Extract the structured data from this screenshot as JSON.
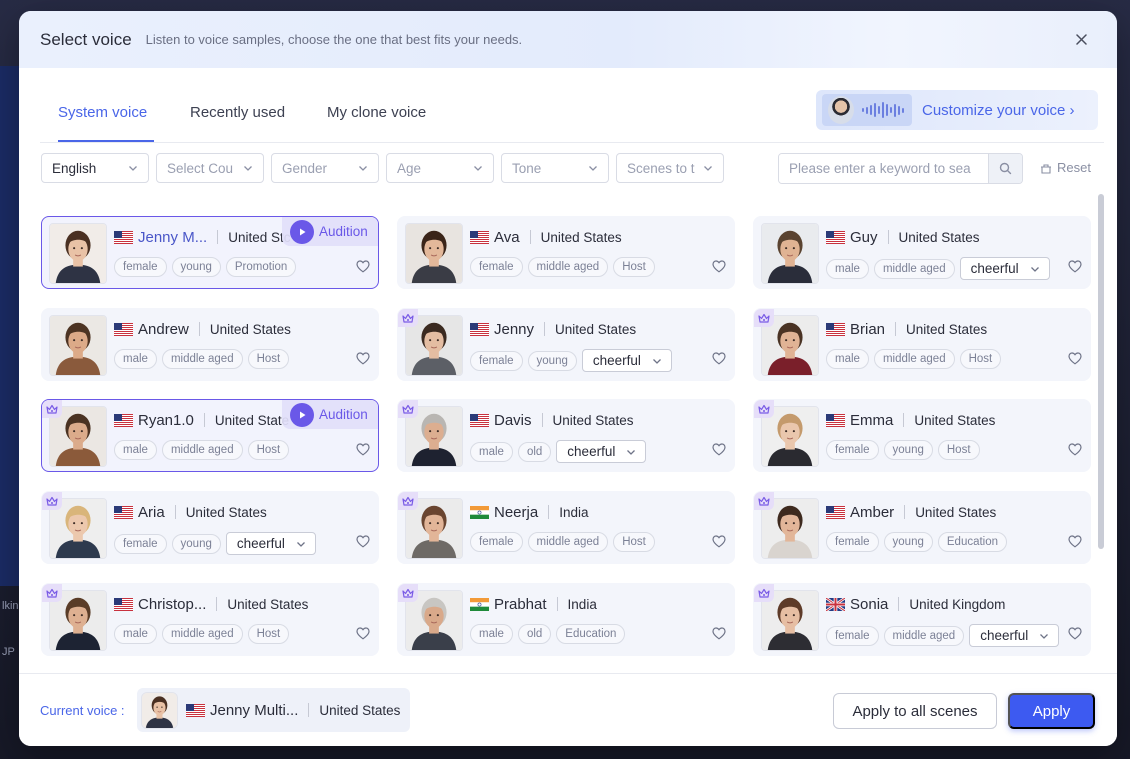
{
  "header": {
    "title": "Select voice",
    "subtitle": "Listen to voice samples, choose the one that best fits your needs."
  },
  "tabs": [
    {
      "label": "System voice",
      "active": true
    },
    {
      "label": "Recently used",
      "active": false
    },
    {
      "label": "My clone voice",
      "active": false
    }
  ],
  "customize": {
    "label": "Customize your voice ›"
  },
  "filters": [
    {
      "value": "English",
      "placeholder": false
    },
    {
      "value": "Select Cou",
      "placeholder": true
    },
    {
      "value": "Gender",
      "placeholder": true
    },
    {
      "value": "Age",
      "placeholder": true
    },
    {
      "value": "Tone",
      "placeholder": true
    },
    {
      "value": "Scenes to t",
      "placeholder": true
    }
  ],
  "search": {
    "placeholder": "Please enter a keyword to sea"
  },
  "reset_label": "Reset",
  "audition_label": "Audition",
  "voices": [
    {
      "name": "Jenny M...",
      "country": "United Stc",
      "flag": "us",
      "tags": [
        "female",
        "young",
        "Promotion"
      ],
      "tone": null,
      "premium": false,
      "selected": true,
      "audition": true,
      "face": {
        "hair": "#4a3022",
        "skin": "#e9c2a6",
        "cloth": "#2e3344",
        "bg": "#f1ece8"
      }
    },
    {
      "name": "Ava",
      "country": "United States",
      "flag": "us",
      "tags": [
        "female",
        "middle aged",
        "Host"
      ],
      "tone": null,
      "premium": false,
      "selected": false,
      "audition": false,
      "face": {
        "hair": "#3a2418",
        "skin": "#e3b89a",
        "cloth": "#3a3c45",
        "bg": "#e8e4e0"
      }
    },
    {
      "name": "Guy",
      "country": "United States",
      "flag": "us",
      "tags": [
        "male",
        "middle aged"
      ],
      "tone": "cheerful",
      "premium": false,
      "selected": false,
      "audition": false,
      "face": {
        "hair": "#5a4330",
        "skin": "#e0b393",
        "cloth": "#2a2d3a",
        "bg": "#e9ebee"
      }
    },
    {
      "name": "Andrew",
      "country": "United States",
      "flag": "us",
      "tags": [
        "male",
        "middle aged",
        "Host"
      ],
      "tone": null,
      "premium": false,
      "selected": false,
      "audition": false,
      "face": {
        "hair": "#4d3423",
        "skin": "#dcaa88",
        "cloth": "#8a5a3c",
        "bg": "#ebe8e4"
      }
    },
    {
      "name": "Jenny",
      "country": "United States",
      "flag": "us",
      "tags": [
        "female",
        "young"
      ],
      "tone": "cheerful",
      "premium": true,
      "selected": false,
      "audition": false,
      "face": {
        "hair": "#3b2a20",
        "skin": "#e4bda2",
        "cloth": "#5c5f66",
        "bg": "#e6e6e6"
      }
    },
    {
      "name": "Brian",
      "country": "United States",
      "flag": "us",
      "tags": [
        "male",
        "middle aged",
        "Host"
      ],
      "tone": null,
      "premium": true,
      "selected": false,
      "audition": false,
      "face": {
        "hair": "#4a3324",
        "skin": "#e0b395",
        "cloth": "#7a1f2a",
        "bg": "#ececec"
      }
    },
    {
      "name": "Ryan1.0",
      "country": "United State",
      "flag": "us",
      "tags": [
        "male",
        "middle aged",
        "Host"
      ],
      "tone": null,
      "premium": true,
      "selected": true,
      "audition": true,
      "face": {
        "hair": "#4a3222",
        "skin": "#dbab8b",
        "cloth": "#8b5a3a",
        "bg": "#ebe7e3"
      }
    },
    {
      "name": "Davis",
      "country": "United States",
      "flag": "us",
      "tags": [
        "male",
        "old"
      ],
      "tone": "cheerful",
      "premium": true,
      "selected": false,
      "audition": false,
      "face": {
        "hair": "#b9b6b2",
        "skin": "#dcae90",
        "cloth": "#1e2230",
        "bg": "#ebebeb"
      }
    },
    {
      "name": "Emma",
      "country": "United States",
      "flag": "us",
      "tags": [
        "female",
        "young",
        "Host"
      ],
      "tone": null,
      "premium": true,
      "selected": false,
      "audition": false,
      "face": {
        "hair": "#c49a6c",
        "skin": "#eac7ad",
        "cloth": "#2a2a30",
        "bg": "#efefef"
      }
    },
    {
      "name": "Aria",
      "country": "United States",
      "flag": "us",
      "tags": [
        "female",
        "young"
      ],
      "tone": "cheerful",
      "premium": true,
      "selected": false,
      "audition": false,
      "face": {
        "hair": "#d9b57a",
        "skin": "#ecc8ad",
        "cloth": "#2e3a4e",
        "bg": "#eeeeee"
      }
    },
    {
      "name": "Neerja",
      "country": "India",
      "flag": "in",
      "tags": [
        "female",
        "middle aged",
        "Host"
      ],
      "tone": null,
      "premium": true,
      "selected": false,
      "audition": false,
      "face": {
        "hair": "#6a4530",
        "skin": "#e2b598",
        "cloth": "#6e6a66",
        "bg": "#ebebeb"
      }
    },
    {
      "name": "Amber",
      "country": "United States",
      "flag": "us",
      "tags": [
        "female",
        "young",
        "Education"
      ],
      "tone": null,
      "premium": true,
      "selected": false,
      "audition": false,
      "face": {
        "hair": "#3e2a1e",
        "skin": "#e2b699",
        "cloth": "#d9d4cf",
        "bg": "#ededed"
      }
    },
    {
      "name": "Christop...",
      "country": "United States",
      "flag": "us",
      "tags": [
        "male",
        "middle aged",
        "Host"
      ],
      "tone": null,
      "premium": true,
      "selected": false,
      "audition": false,
      "face": {
        "hair": "#5a3d28",
        "skin": "#deb091",
        "cloth": "#1d2333",
        "bg": "#ececec"
      }
    },
    {
      "name": "Prabhat",
      "country": "India",
      "flag": "in",
      "tags": [
        "male",
        "old",
        "Education"
      ],
      "tone": null,
      "premium": true,
      "selected": false,
      "audition": false,
      "face": {
        "hair": "#c8c6c2",
        "skin": "#d9a98a",
        "cloth": "#3a3f4a",
        "bg": "#ececec"
      }
    },
    {
      "name": "Sonia",
      "country": "United Kingdom",
      "flag": "gb",
      "tags": [
        "female",
        "middle aged"
      ],
      "tone": "cheerful",
      "premium": true,
      "selected": false,
      "audition": false,
      "face": {
        "hair": "#5e3b28",
        "skin": "#e6bea3",
        "cloth": "#2d2d33",
        "bg": "#ededed"
      }
    },
    {
      "name": "",
      "country": "",
      "flag": "",
      "tags": [],
      "tone": null,
      "premium": true,
      "selected": false,
      "audition": false,
      "face": {
        "hair": "#3a2a20",
        "skin": "#e3b89a",
        "cloth": "#333",
        "bg": "#e8e8e8"
      }
    },
    {
      "name": "",
      "country": "",
      "flag": "",
      "tags": [],
      "tone": null,
      "premium": true,
      "selected": false,
      "audition": false,
      "face": {
        "hair": "#222",
        "skin": "#d9ad90",
        "cloth": "#333",
        "bg": "#e8e8e8"
      }
    },
    {
      "name": "",
      "country": "",
      "flag": "",
      "tags": [],
      "tone": null,
      "premium": true,
      "selected": false,
      "audition": false,
      "face": {
        "hair": "#3a2a20",
        "skin": "#e3b89a",
        "cloth": "#333",
        "bg": "#e8e8e8"
      }
    }
  ],
  "footer": {
    "current_label": "Current voice :",
    "current_name": "Jenny Multi...",
    "current_country": "United States",
    "apply_all_label": "Apply to all scenes",
    "apply_label": "Apply"
  },
  "background": {
    "text1": "lkin",
    "text2": "JP"
  },
  "colors": {
    "accent": "#4a66e8",
    "primary_button": "#3d5af1",
    "selected_border": "#6a58e8"
  }
}
